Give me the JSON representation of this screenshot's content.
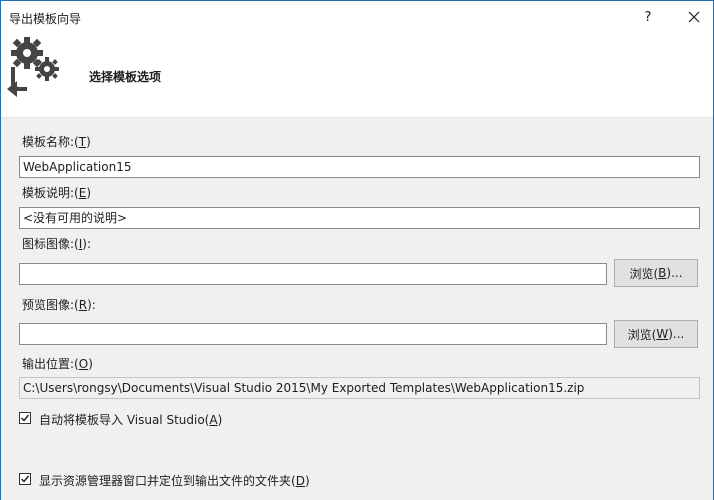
{
  "window": {
    "title": "导出模板向导",
    "help_label": "?"
  },
  "header": {
    "title": "选择模板选项",
    "icon": "gears-export-icon"
  },
  "form": {
    "name": {
      "label": "模板名称:(",
      "key": "T",
      "suffix": ")",
      "value": "WebApplication15"
    },
    "description": {
      "label": "模板说明:(",
      "key": "E",
      "suffix": ")",
      "value": "<没有可用的说明>"
    },
    "icon_image": {
      "label": "图标图像:(",
      "key": "I",
      "suffix": "):",
      "value": "",
      "browse_label": "浏览(",
      "browse_key": "B",
      "browse_suffix": ")..."
    },
    "preview_image": {
      "label": "预览图像:(",
      "key": "R",
      "suffix": "):",
      "value": "",
      "browse_label": "浏览(",
      "browse_key": "W",
      "browse_suffix": ")..."
    },
    "output_location": {
      "label": "输出位置:(",
      "key": "O",
      "suffix": ")",
      "value": "C:\\Users\\rongsy\\Documents\\Visual Studio 2015\\My Exported Templates\\WebApplication15.zip"
    },
    "auto_import": {
      "label": "自动将模板导入 Visual Studio(",
      "key": "A",
      "suffix": ")",
      "checked": true
    },
    "show_explorer": {
      "label": "显示资源管理器窗口并定位到输出文件的文件夹(",
      "key": "D",
      "suffix": ")",
      "checked": true
    }
  },
  "colors": {
    "accent_border": "#1f6fb5",
    "content_bg": "#f0f0f0"
  }
}
